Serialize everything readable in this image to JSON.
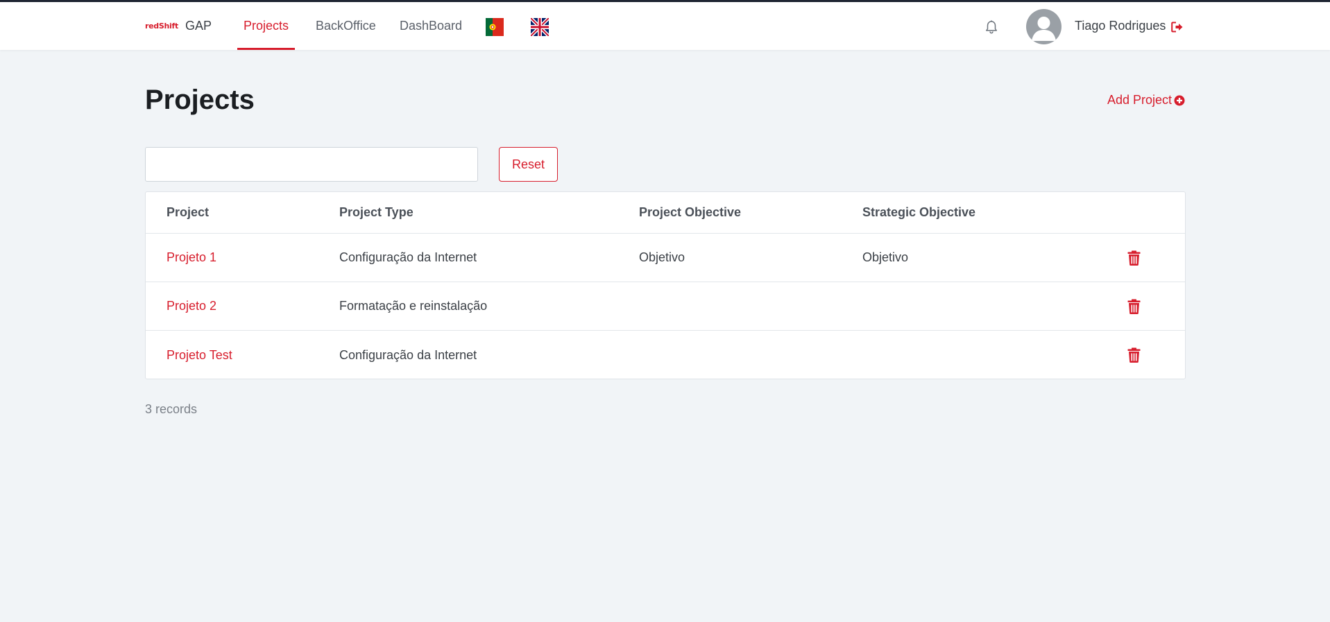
{
  "app": {
    "brand_logo": "redShift",
    "brand_name": "GAP"
  },
  "nav": {
    "items": [
      {
        "label": "Projects",
        "active": true
      },
      {
        "label": "BackOffice",
        "active": false
      },
      {
        "label": "DashBoard",
        "active": false
      }
    ],
    "flags": [
      "portugal-flag-icon",
      "uk-flag-icon"
    ]
  },
  "user": {
    "name": "Tiago Rodrigues"
  },
  "page": {
    "title": "Projects",
    "add_label": "Add Project"
  },
  "search": {
    "value": "",
    "placeholder": ""
  },
  "reset_label": "Reset",
  "table": {
    "columns": [
      "Project",
      "Project Type",
      "Project Objective",
      "Strategic Objective"
    ],
    "rows": [
      {
        "project": "Projeto 1",
        "type": "Configuração da Internet",
        "objective": "Objetivo",
        "strategic": "Objetivo"
      },
      {
        "project": "Projeto 2",
        "type": "Formatação e reinstalação",
        "objective": "",
        "strategic": ""
      },
      {
        "project": "Projeto Test",
        "type": "Configuração da Internet",
        "objective": "",
        "strategic": ""
      }
    ]
  },
  "footer": {
    "records": "3 records"
  },
  "colors": {
    "accent": "#d71d2c",
    "background": "#f1f4f7",
    "topline": "#1f2533"
  }
}
